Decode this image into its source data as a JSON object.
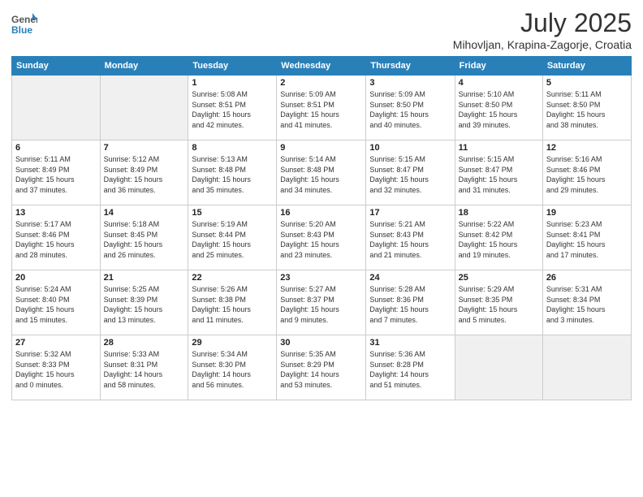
{
  "header": {
    "logo_general": "General",
    "logo_blue": "Blue",
    "title": "July 2025",
    "subtitle": "Mihovljan, Krapina-Zagorje, Croatia"
  },
  "weekdays": [
    "Sunday",
    "Monday",
    "Tuesday",
    "Wednesday",
    "Thursday",
    "Friday",
    "Saturday"
  ],
  "weeks": [
    [
      {
        "day": "",
        "info": ""
      },
      {
        "day": "",
        "info": ""
      },
      {
        "day": "1",
        "info": "Sunrise: 5:08 AM\nSunset: 8:51 PM\nDaylight: 15 hours\nand 42 minutes."
      },
      {
        "day": "2",
        "info": "Sunrise: 5:09 AM\nSunset: 8:51 PM\nDaylight: 15 hours\nand 41 minutes."
      },
      {
        "day": "3",
        "info": "Sunrise: 5:09 AM\nSunset: 8:50 PM\nDaylight: 15 hours\nand 40 minutes."
      },
      {
        "day": "4",
        "info": "Sunrise: 5:10 AM\nSunset: 8:50 PM\nDaylight: 15 hours\nand 39 minutes."
      },
      {
        "day": "5",
        "info": "Sunrise: 5:11 AM\nSunset: 8:50 PM\nDaylight: 15 hours\nand 38 minutes."
      }
    ],
    [
      {
        "day": "6",
        "info": "Sunrise: 5:11 AM\nSunset: 8:49 PM\nDaylight: 15 hours\nand 37 minutes."
      },
      {
        "day": "7",
        "info": "Sunrise: 5:12 AM\nSunset: 8:49 PM\nDaylight: 15 hours\nand 36 minutes."
      },
      {
        "day": "8",
        "info": "Sunrise: 5:13 AM\nSunset: 8:48 PM\nDaylight: 15 hours\nand 35 minutes."
      },
      {
        "day": "9",
        "info": "Sunrise: 5:14 AM\nSunset: 8:48 PM\nDaylight: 15 hours\nand 34 minutes."
      },
      {
        "day": "10",
        "info": "Sunrise: 5:15 AM\nSunset: 8:47 PM\nDaylight: 15 hours\nand 32 minutes."
      },
      {
        "day": "11",
        "info": "Sunrise: 5:15 AM\nSunset: 8:47 PM\nDaylight: 15 hours\nand 31 minutes."
      },
      {
        "day": "12",
        "info": "Sunrise: 5:16 AM\nSunset: 8:46 PM\nDaylight: 15 hours\nand 29 minutes."
      }
    ],
    [
      {
        "day": "13",
        "info": "Sunrise: 5:17 AM\nSunset: 8:46 PM\nDaylight: 15 hours\nand 28 minutes."
      },
      {
        "day": "14",
        "info": "Sunrise: 5:18 AM\nSunset: 8:45 PM\nDaylight: 15 hours\nand 26 minutes."
      },
      {
        "day": "15",
        "info": "Sunrise: 5:19 AM\nSunset: 8:44 PM\nDaylight: 15 hours\nand 25 minutes."
      },
      {
        "day": "16",
        "info": "Sunrise: 5:20 AM\nSunset: 8:43 PM\nDaylight: 15 hours\nand 23 minutes."
      },
      {
        "day": "17",
        "info": "Sunrise: 5:21 AM\nSunset: 8:43 PM\nDaylight: 15 hours\nand 21 minutes."
      },
      {
        "day": "18",
        "info": "Sunrise: 5:22 AM\nSunset: 8:42 PM\nDaylight: 15 hours\nand 19 minutes."
      },
      {
        "day": "19",
        "info": "Sunrise: 5:23 AM\nSunset: 8:41 PM\nDaylight: 15 hours\nand 17 minutes."
      }
    ],
    [
      {
        "day": "20",
        "info": "Sunrise: 5:24 AM\nSunset: 8:40 PM\nDaylight: 15 hours\nand 15 minutes."
      },
      {
        "day": "21",
        "info": "Sunrise: 5:25 AM\nSunset: 8:39 PM\nDaylight: 15 hours\nand 13 minutes."
      },
      {
        "day": "22",
        "info": "Sunrise: 5:26 AM\nSunset: 8:38 PM\nDaylight: 15 hours\nand 11 minutes."
      },
      {
        "day": "23",
        "info": "Sunrise: 5:27 AM\nSunset: 8:37 PM\nDaylight: 15 hours\nand 9 minutes."
      },
      {
        "day": "24",
        "info": "Sunrise: 5:28 AM\nSunset: 8:36 PM\nDaylight: 15 hours\nand 7 minutes."
      },
      {
        "day": "25",
        "info": "Sunrise: 5:29 AM\nSunset: 8:35 PM\nDaylight: 15 hours\nand 5 minutes."
      },
      {
        "day": "26",
        "info": "Sunrise: 5:31 AM\nSunset: 8:34 PM\nDaylight: 15 hours\nand 3 minutes."
      }
    ],
    [
      {
        "day": "27",
        "info": "Sunrise: 5:32 AM\nSunset: 8:33 PM\nDaylight: 15 hours\nand 0 minutes."
      },
      {
        "day": "28",
        "info": "Sunrise: 5:33 AM\nSunset: 8:31 PM\nDaylight: 14 hours\nand 58 minutes."
      },
      {
        "day": "29",
        "info": "Sunrise: 5:34 AM\nSunset: 8:30 PM\nDaylight: 14 hours\nand 56 minutes."
      },
      {
        "day": "30",
        "info": "Sunrise: 5:35 AM\nSunset: 8:29 PM\nDaylight: 14 hours\nand 53 minutes."
      },
      {
        "day": "31",
        "info": "Sunrise: 5:36 AM\nSunset: 8:28 PM\nDaylight: 14 hours\nand 51 minutes."
      },
      {
        "day": "",
        "info": ""
      },
      {
        "day": "",
        "info": ""
      }
    ]
  ]
}
